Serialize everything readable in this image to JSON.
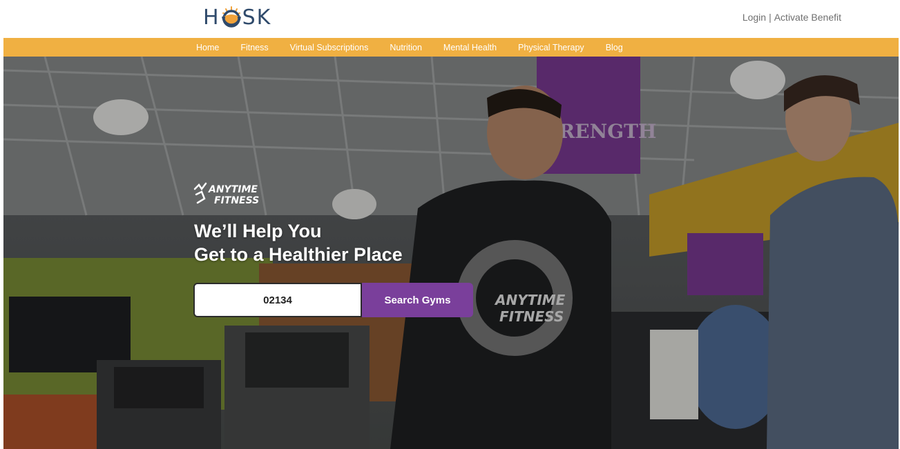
{
  "header": {
    "logo_letters": [
      "H",
      "S",
      "K"
    ],
    "login_label": "Login",
    "separator": "|",
    "activate_label": "Activate Benefit"
  },
  "nav": {
    "items": [
      {
        "label": "Home"
      },
      {
        "label": "Fitness"
      },
      {
        "label": "Virtual Subscriptions"
      },
      {
        "label": "Nutrition"
      },
      {
        "label": "Mental Health"
      },
      {
        "label": "Physical Therapy"
      },
      {
        "label": "Blog"
      }
    ]
  },
  "hero": {
    "brand_line1": "ANYTIME",
    "brand_line2": "FITNESS",
    "headline_line1": "We’ll Help You",
    "headline_line2": "Get to a Healthier Place",
    "zip_value": "02134",
    "search_button_label": "Search Gyms",
    "banner_text": "RENGTH"
  },
  "colors": {
    "nav_bar": "#f0b042",
    "search_button": "#7a3f9b",
    "logo_text": "#2f4a6b",
    "logo_sun": "#f2a33a",
    "banner_purple": "#7b3a93"
  }
}
